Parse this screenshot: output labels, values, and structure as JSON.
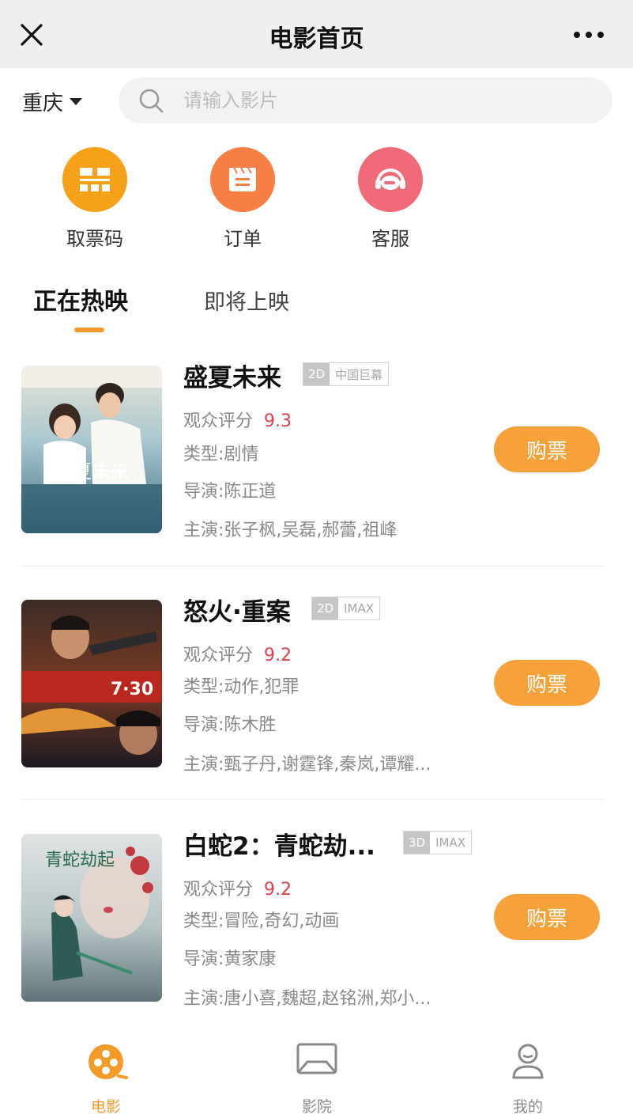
{
  "header": {
    "title": "电影首页",
    "close_icon": "close-icon",
    "more_icon": "more-dots-icon"
  },
  "location": {
    "city": "重庆"
  },
  "search": {
    "placeholder": "请输入影片",
    "value": ""
  },
  "quick_entries": [
    {
      "label": "取票码",
      "icon": "ticket-code-icon",
      "color": "#f5a21a"
    },
    {
      "label": "订单",
      "icon": "order-icon",
      "color": "#f77f45"
    },
    {
      "label": "客服",
      "icon": "customer-service-icon",
      "color": "#f06a7a"
    }
  ],
  "tabs": [
    {
      "label": "正在热映",
      "active": true
    },
    {
      "label": "即将上映",
      "active": false
    }
  ],
  "movies": [
    {
      "title": "盛夏未来",
      "dimension": "2D",
      "format": "中国巨幕",
      "rating_label": "观众评分",
      "rating": "9.3",
      "genre": "类型:剧情",
      "director": "导演:陈正道",
      "cast": "主演:张子枫,吴磊,郝蕾,祖峰",
      "buy_label": "购票",
      "poster_text": "盛夏未来"
    },
    {
      "title": "怒火·重案",
      "dimension": "2D",
      "format": "IMAX",
      "rating_label": "观众评分",
      "rating": "9.2",
      "genre": "类型:动作,犯罪",
      "director": "导演:陈木胜",
      "cast": "主演:甄子丹,谢霆锋,秦岚,谭耀...",
      "buy_label": "购票",
      "poster_text": "7·30"
    },
    {
      "title": "白蛇2：青蛇劫...",
      "dimension": "3D",
      "format": "IMAX",
      "rating_label": "观众评分",
      "rating": "9.2",
      "genre": "类型:冒险,奇幻,动画",
      "director": "导演:黄家康",
      "cast": "主演:唐小喜,魏超,赵铭洲,郑小...",
      "buy_label": "购票",
      "poster_text": "青蛇劫起"
    }
  ],
  "bottom_nav": [
    {
      "label": "电影",
      "icon": "film-reel-icon",
      "active": true
    },
    {
      "label": "影院",
      "icon": "cinema-screen-icon",
      "active": false
    },
    {
      "label": "我的",
      "icon": "user-profile-icon",
      "active": false
    }
  ],
  "colors": {
    "accent": "#f39a2a",
    "buy_button": "#f7a13a",
    "score": "#e0414b"
  }
}
